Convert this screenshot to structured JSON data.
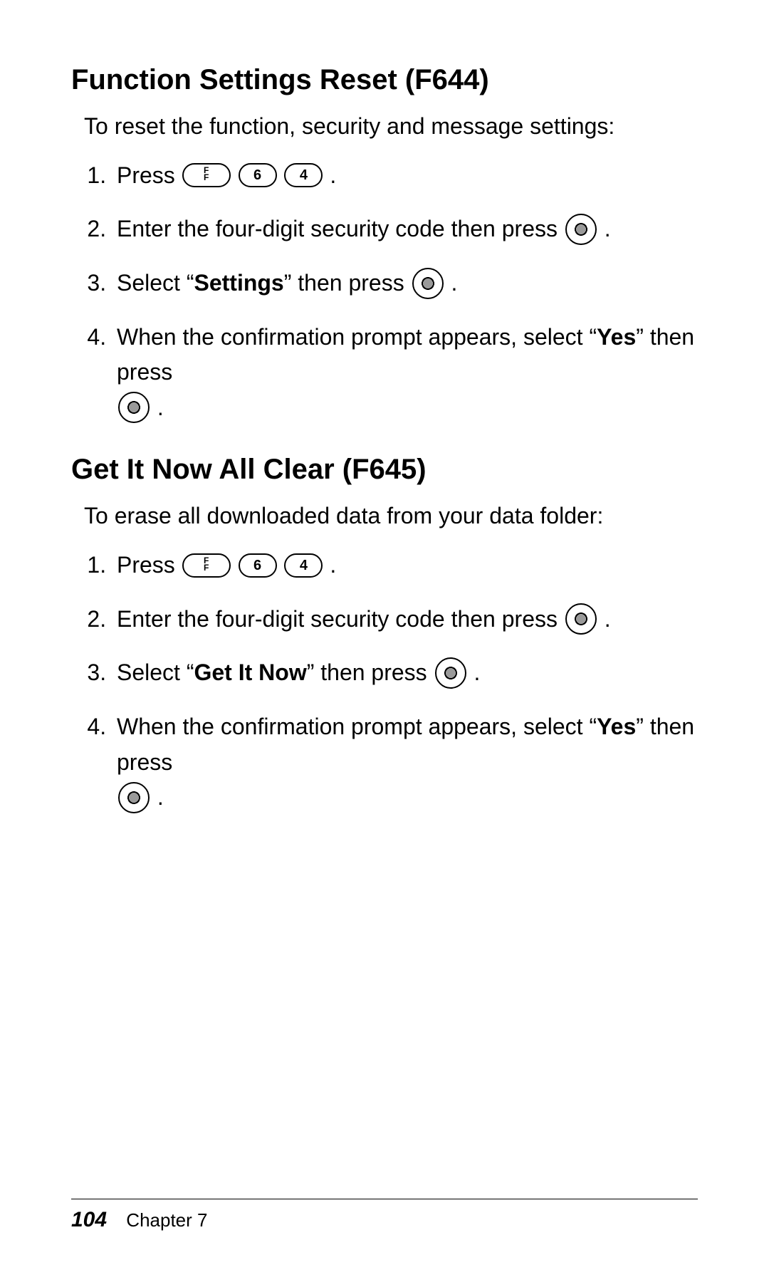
{
  "section1": {
    "title": "Function Settings Reset (F644)",
    "intro": "To reset the function, security and message settings:",
    "steps": {
      "s1a": "Press ",
      "s1b": ".",
      "s2a": "Enter the four-digit security code then press ",
      "s2b": ".",
      "s3a": "Select “",
      "s3bold": "Settings",
      "s3b": "” then press ",
      "s3c": ".",
      "s4a": "When the confirmation prompt appears, select “",
      "s4bold": "Yes",
      "s4b": "” then press ",
      "s4c": "."
    }
  },
  "section2": {
    "title": "Get It Now All Clear (F645)",
    "intro": "To erase all downloaded data from your data folder:",
    "steps": {
      "s1a": "Press ",
      "s1b": ".",
      "s2a": "Enter the four-digit security code then press ",
      "s2b": ".",
      "s3a": "Select “",
      "s3bold": "Get It Now",
      "s3b": "” then press ",
      "s3c": ".",
      "s4a": "When the confirmation prompt appears, select “",
      "s4bold": "Yes",
      "s4b": "” then press ",
      "s4c": "."
    }
  },
  "keys": {
    "f": "F",
    "six": "6",
    "four": "4"
  },
  "footer": {
    "page": "104",
    "chapter": "Chapter 7"
  }
}
